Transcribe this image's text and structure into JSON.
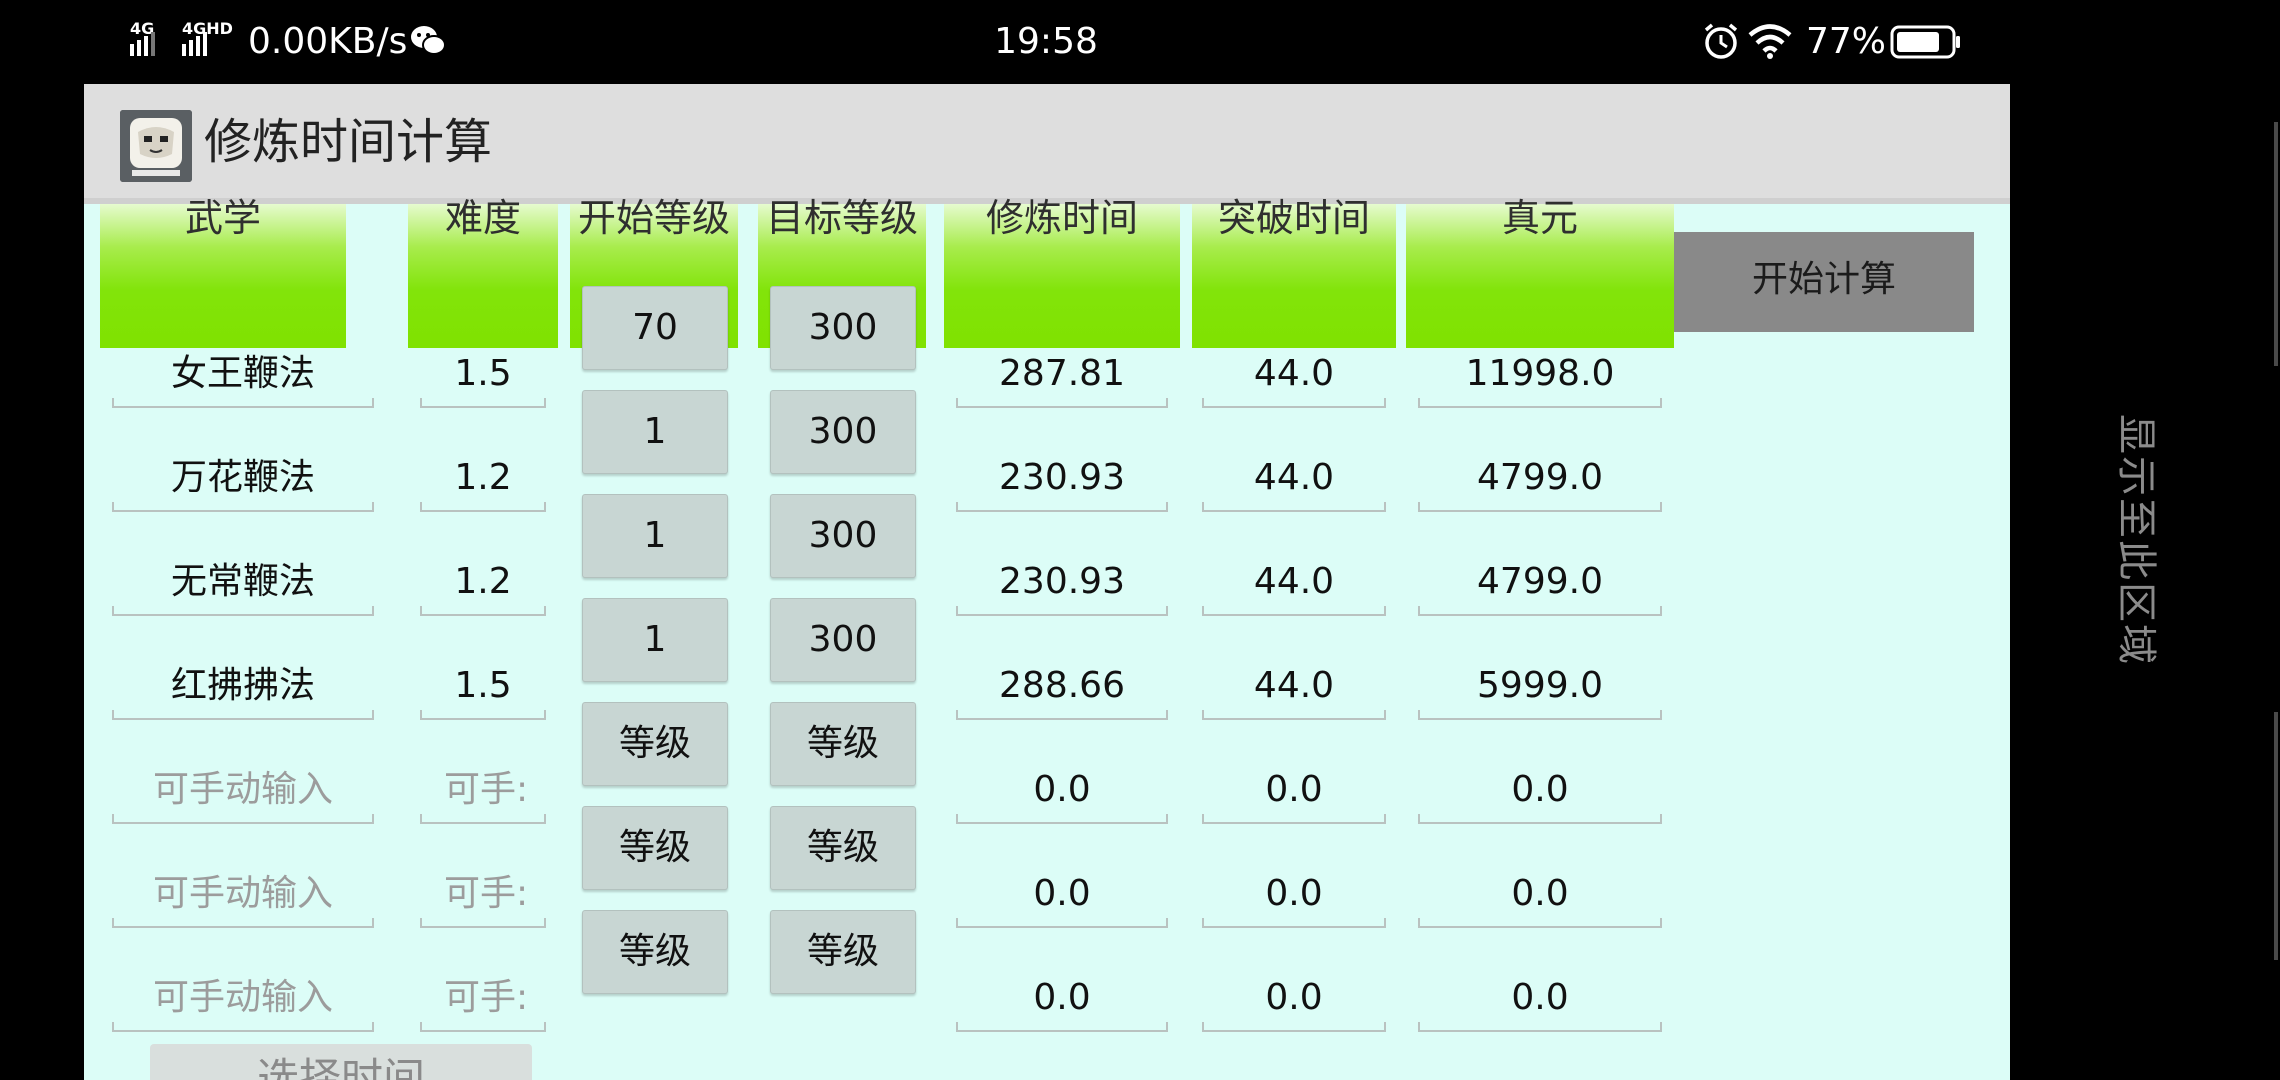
{
  "status_bar": {
    "network_1": "4G",
    "network_2": "4GHD",
    "net_speed": "0.00KB/s",
    "time": "19:58",
    "battery": "77%",
    "icons": [
      "signal-icon",
      "wechat-icon",
      "alarm-icon",
      "wifi-icon",
      "battery-icon"
    ]
  },
  "app": {
    "title": "修炼时间计算"
  },
  "table": {
    "headers": [
      "武学",
      "难度",
      "开始等级",
      "目标等级",
      "修炼时间",
      "突破时间",
      "真元"
    ],
    "rows": [
      {
        "skill": "女王鞭法",
        "difficulty": "1.5",
        "start": "70",
        "target": "300",
        "train_time": "287.81",
        "break_time": "44.0",
        "zhenyuan": "11998.0"
      },
      {
        "skill": "万花鞭法",
        "difficulty": "1.2",
        "start": "1",
        "target": "300",
        "train_time": "230.93",
        "break_time": "44.0",
        "zhenyuan": "4799.0"
      },
      {
        "skill": "无常鞭法",
        "difficulty": "1.2",
        "start": "1",
        "target": "300",
        "train_time": "230.93",
        "break_time": "44.0",
        "zhenyuan": "4799.0"
      },
      {
        "skill": "红拂拂法",
        "difficulty": "1.5",
        "start": "1",
        "target": "300",
        "train_time": "288.66",
        "break_time": "44.0",
        "zhenyuan": "5999.0"
      },
      {
        "skill_placeholder": "可手动输入",
        "difficulty_placeholder": "可手:",
        "start": "等级",
        "target": "等级",
        "train_time": "0.0",
        "break_time": "0.0",
        "zhenyuan": "0.0"
      },
      {
        "skill_placeholder": "可手动输入",
        "difficulty_placeholder": "可手:",
        "start": "等级",
        "target": "等级",
        "train_time": "0.0",
        "break_time": "0.0",
        "zhenyuan": "0.0"
      },
      {
        "skill_placeholder": "可手动输入",
        "difficulty_placeholder": "可手:",
        "start": "等级",
        "target": "等级",
        "train_time": "0.0",
        "break_time": "0.0",
        "zhenyuan": "0.0"
      }
    ]
  },
  "buttons": {
    "calculate": "开始计算",
    "select_partial": "选择时间"
  },
  "side": {
    "label": "显示至此区域"
  },
  "colors": {
    "header_green": "#80e200",
    "app_bg": "#dcfdf7",
    "level_button": "#c8d6d3",
    "calc_button": "#898989"
  }
}
